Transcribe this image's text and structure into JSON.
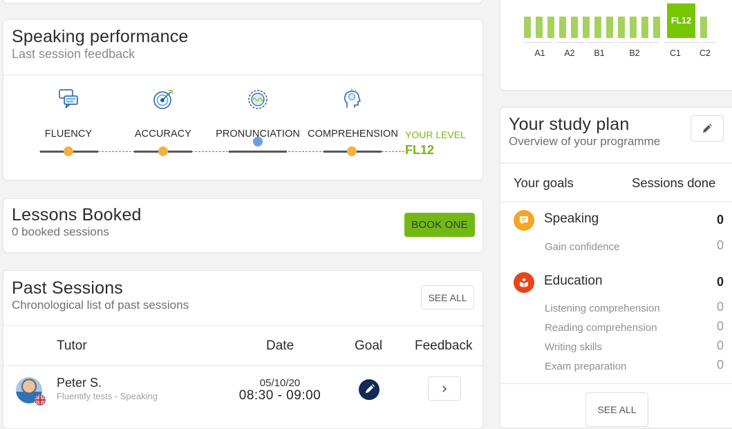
{
  "speaking": {
    "title": "Speaking performance",
    "subtitle": "Last session feedback",
    "skills": [
      {
        "label": "FLUENCY",
        "icon": "chat-bubbles-icon",
        "dot_color": "#f5b042"
      },
      {
        "label": "ACCURACY",
        "icon": "target-icon",
        "dot_color": "#f5b042"
      },
      {
        "label": "PRONUNCIATION",
        "icon": "pronunciation-icon",
        "dot_color": "#6a9fe5"
      },
      {
        "label": "COMPREHENSION",
        "icon": "head-lightbulb-icon",
        "dot_color": "#f5b042"
      }
    ],
    "your_level_label": "YOUR LEVEL",
    "your_level_value": "FL12"
  },
  "lessons": {
    "title": "Lessons Booked",
    "subtitle": "0 booked sessions",
    "book_label": "BOOK ONE"
  },
  "past": {
    "title": "Past Sessions",
    "subtitle": "Chronological list of past sessions",
    "see_all_label": "SEE ALL",
    "columns": {
      "tutor": "Tutor",
      "date": "Date",
      "goal": "Goal",
      "feedback": "Feedback"
    },
    "rows": [
      {
        "tutor": "Peter S.",
        "course": "Fluentify tests - Speaking",
        "date": "05/10/20",
        "time": "08:30 - 09:00"
      }
    ]
  },
  "level_scale": {
    "current": "FL12",
    "labels": [
      "A1",
      "A2",
      "B1",
      "B2",
      "C1",
      "C2"
    ],
    "accent": "#76c700"
  },
  "plan": {
    "title": "Your study plan",
    "subtitle": "Overview of your programme",
    "goals_header": "Your goals",
    "sessions_header": "Sessions done",
    "goals": [
      {
        "title": "Speaking",
        "count": "0",
        "icon": "speech-bubble-icon",
        "color": "#f5a623",
        "items": [
          {
            "label": "Gain confidence",
            "count": "0"
          }
        ]
      },
      {
        "title": "Education",
        "count": "0",
        "icon": "book-person-icon",
        "color": "#e8441a",
        "items": [
          {
            "label": "Listening comprehension",
            "count": "0"
          },
          {
            "label": "Reading comprehension",
            "count": "0"
          },
          {
            "label": "Writing skills",
            "count": "0"
          },
          {
            "label": "Exam preparation",
            "count": "0"
          }
        ]
      }
    ],
    "see_all_label": "SEE ALL"
  }
}
